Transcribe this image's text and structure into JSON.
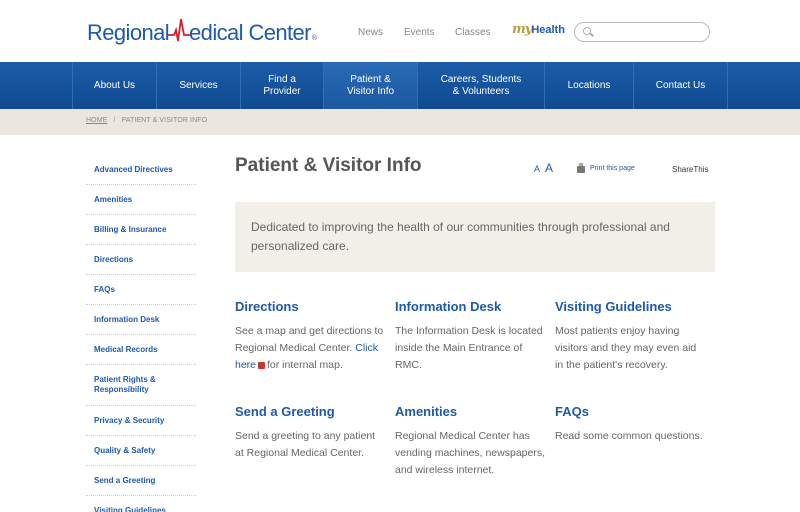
{
  "logo": {
    "part1": "Regional ",
    "part2": "edical Center",
    "reg": "®"
  },
  "topnav": {
    "news": "News",
    "events": "Events",
    "classes": "Classes"
  },
  "myhealth": {
    "my": "my",
    "health": "Health"
  },
  "search": {
    "placeholder": ""
  },
  "mainnav": {
    "items": [
      {
        "label": "About Us"
      },
      {
        "label": "Services"
      },
      {
        "line1": "Find a",
        "line2": "Provider"
      },
      {
        "line1": "Patient &",
        "line2": "Visitor Info"
      },
      {
        "line1": "Careers, Students",
        "line2": "& Volunteers"
      },
      {
        "label": "Locations"
      },
      {
        "label": "Contact Us"
      }
    ]
  },
  "breadcrumb": {
    "home": "HOME",
    "sep": "/",
    "current": "PATIENT & VISITOR INFO"
  },
  "sidebar": {
    "items": [
      {
        "label": "Advanced Directives"
      },
      {
        "label": "Amenities"
      },
      {
        "label": "Billing & Insurance"
      },
      {
        "label": "Directions"
      },
      {
        "label": "FAQs"
      },
      {
        "label": "Information Desk"
      },
      {
        "label": "Medical Records"
      },
      {
        "label": "Patient Rights & Responsibility"
      },
      {
        "label": "Privacy & Security"
      },
      {
        "label": "Quality & Safety"
      },
      {
        "label": "Send a Greeting"
      },
      {
        "label": "Visiting Guidelines"
      }
    ]
  },
  "page": {
    "title": "Patient & Visitor Info",
    "font_small": "A",
    "font_large": "A",
    "print": "Print this page",
    "share": "ShareThis",
    "intro": "Dedicated to improving the health of our communities through professional and personalized care."
  },
  "cards": [
    {
      "title": "Directions",
      "text": "See a map and get directions to Regional Medical Center.",
      "link": "Click here",
      "suffix": "for internal map."
    },
    {
      "title": "Information Desk",
      "text": "The Information Desk is located inside the Main Entrance of RMC."
    },
    {
      "title": "Visiting Guidelines",
      "text": "Most patients enjoy having visitors and they may even aid in the patient's recovery."
    },
    {
      "title": "Send a Greeting",
      "text": "Send a greeting to any patient at Regional Medical Center."
    },
    {
      "title": "Amenities",
      "text": "Regional Medical Center has vending machines, newspapers, and wireless internet."
    },
    {
      "title": "FAQs",
      "text": "Read some common questions."
    }
  ],
  "colors": {
    "brand_blue": "#1e5aa8",
    "nav_blue": "#0f4a91",
    "accent_red": "#cc2233",
    "gold": "#c19a3a"
  }
}
